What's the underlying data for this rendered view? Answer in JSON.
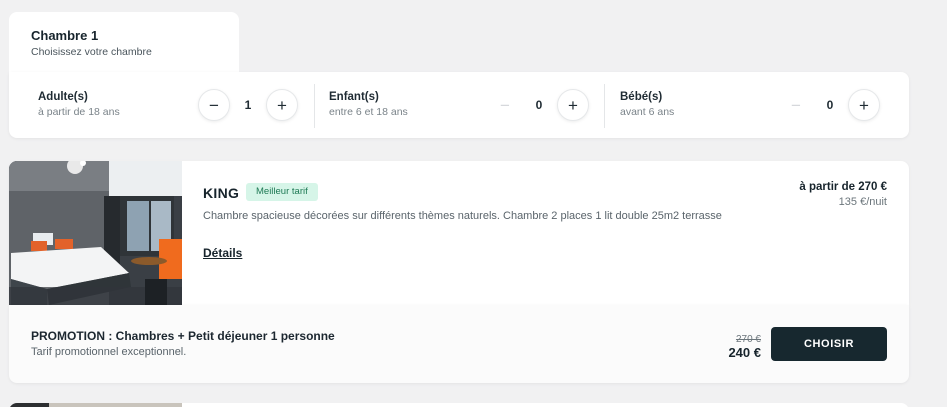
{
  "tabs": {
    "active_title": "Chambre 1",
    "active_subtitle": "Choisissez votre chambre"
  },
  "occupancy": {
    "adults": {
      "label": "Adulte(s)",
      "sub": "à partir de 18 ans",
      "value": "1",
      "minus": "−",
      "plus": "+"
    },
    "children": {
      "label": "Enfant(s)",
      "sub": "entre 6 et 18 ans",
      "value": "0",
      "minus": "−",
      "plus": "+"
    },
    "babies": {
      "label": "Bébé(s)",
      "sub": "avant 6 ans",
      "value": "0",
      "minus": "−",
      "plus": "+"
    }
  },
  "room": {
    "name": "KING",
    "badge": "Meilleur tarif",
    "description": "Chambre spacieuse décorées sur différents thèmes naturels. Chambre 2 places 1 lit double 25m2 terrasse",
    "details_link": "Détails",
    "price_from": "à partir de 270 €",
    "price_night": "135 €/nuit"
  },
  "offer": {
    "title": "PROMOTION : Chambres + Petit déjeuner 1 personne",
    "subtitle": "Tarif promotionnel exceptionnel.",
    "old_price": "270 €",
    "new_price": "240 €",
    "button": "CHOISIR"
  },
  "colors": {
    "page_bg": "#f1f1f2",
    "primary_button": "#17282f",
    "badge_bg": "#d6f5e8",
    "badge_text": "#1f7a55"
  }
}
